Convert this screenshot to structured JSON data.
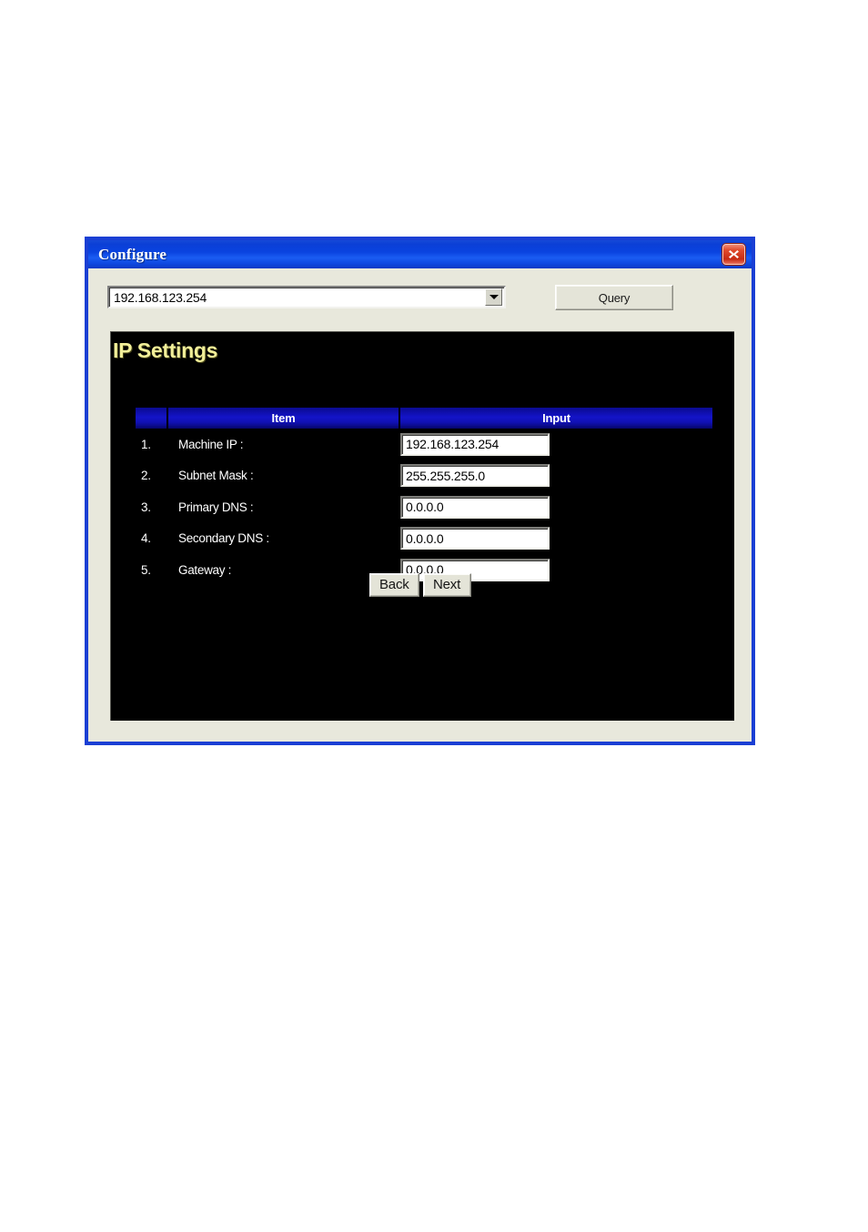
{
  "window": {
    "title": "Configure",
    "close_icon": "close-icon"
  },
  "toolbar": {
    "ip_combo_value": "192.168.123.254",
    "ip_combo_placeholder": "192.168.123.254",
    "dropdown_icon": "chevron-down-icon",
    "query_label": "Query"
  },
  "panel": {
    "heading": "IP Settings",
    "heading_color": "#f2ef99",
    "background_color": "#000000"
  },
  "table": {
    "header_color": "#1414c8",
    "columns": {
      "number": "",
      "item": "Item",
      "input": "Input"
    },
    "rows": [
      {
        "num": "1.",
        "label": "Machine IP :",
        "value": "192.168.123.254"
      },
      {
        "num": "2.",
        "label": "Subnet Mask :",
        "value": "255.255.255.0"
      },
      {
        "num": "3.",
        "label": "Primary DNS :",
        "value": "0.0.0.0"
      },
      {
        "num": "4.",
        "label": "Secondary DNS :",
        "value": "0.0.0.0"
      },
      {
        "num": "5.",
        "label": "Gateway :",
        "value": "0.0.0.0"
      }
    ]
  },
  "actions": {
    "back_label": "Back",
    "next_label": "Next"
  }
}
